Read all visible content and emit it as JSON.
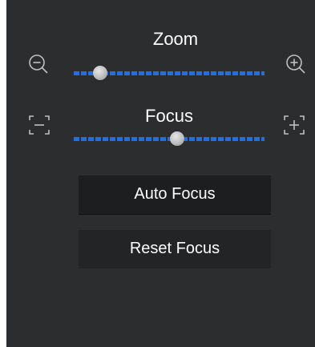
{
  "zoom": {
    "label": "Zoom",
    "out_icon": "zoom-out-icon",
    "in_icon": "zoom-in-icon",
    "value": 0.14
  },
  "focus": {
    "label": "Focus",
    "minus_icon": "focus-minus-icon",
    "plus_icon": "focus-plus-icon",
    "value": 0.54
  },
  "buttons": {
    "auto_focus": "Auto Focus",
    "reset_focus": "Reset Focus"
  },
  "colors": {
    "panel_bg": "#2b2d2e",
    "slider_track": "#1f6fe5",
    "button_bg": "#1c1e20",
    "text": "#ffffff"
  }
}
